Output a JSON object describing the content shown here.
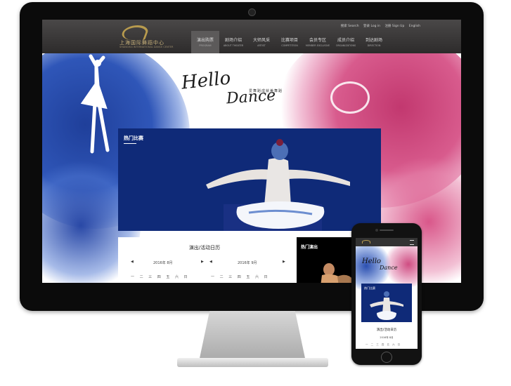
{
  "header": {
    "logo_cn": "上海国际舞蹈中心",
    "logo_en": "SHANGHAI INTERNATIONAL DANCE CENTER",
    "top_links": {
      "search": "搜索 Search",
      "login": "登录 Log in",
      "signup": "注册 Sign Up",
      "language": "English"
    },
    "nav": [
      {
        "cn": "演出购票",
        "en": "PROGRAM"
      },
      {
        "cn": "剧场介绍",
        "en": "ABOUT THEATER"
      },
      {
        "cn": "大师风采",
        "en": "ARTIST"
      },
      {
        "cn": "比赛项目",
        "en": "COMPETITION"
      },
      {
        "cn": "会员专区",
        "en": "MEMBER EXCLUSIVE"
      },
      {
        "cn": "成员介绍",
        "en": "ORGANIZATIONS"
      },
      {
        "cn": "到达剧场",
        "en": "DIRECTION"
      }
    ]
  },
  "hero": {
    "hello": "Hello",
    "dance": "Dance",
    "slogan": "爱舞蹈成就美舞蹈"
  },
  "hot_competition": {
    "title": "热门比赛"
  },
  "calendar": {
    "title": "演出/活动日历",
    "month1": "2016年 8月",
    "month2": "2016年 9月",
    "weekdays1": "一 二 三 四 五 六 日",
    "weekdays2": "一 二 三 四 五 六 日"
  },
  "hot_performance": {
    "title": "热门演出"
  },
  "phone": {
    "hello": "Hello",
    "dance": "Dance",
    "hot_title": "热门比赛",
    "calendar_title": "演出/活动日历",
    "month": "2016年 8月",
    "weekdays": "一 二 三 四 五 六 日"
  },
  "colors": {
    "header_bg": "#2d2b2b",
    "gold": "#b89b4e",
    "splash_blue": "#1f3f9a",
    "splash_pink": "#d2457d",
    "competition_bg": "#0f2a78"
  }
}
